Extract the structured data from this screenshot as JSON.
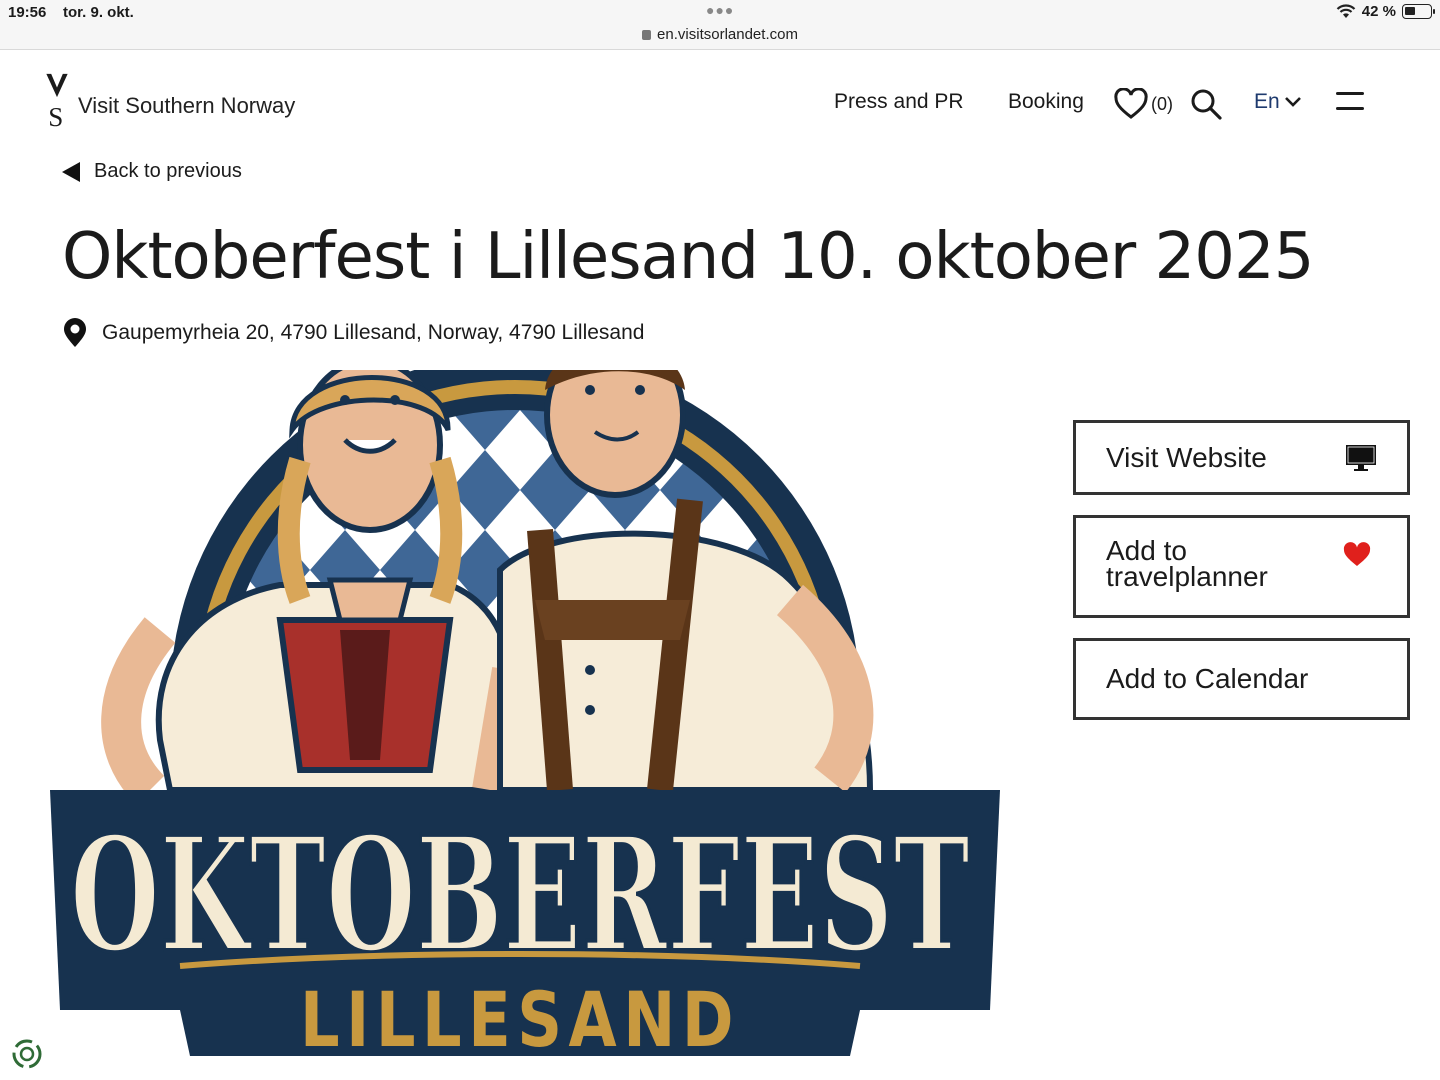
{
  "statusbar": {
    "time": "19:56",
    "date": "tor. 9. okt.",
    "url": "en.visitsorlandet.com",
    "battery": "42 %",
    "battery_level": 0.42
  },
  "header": {
    "logo_text": "Visit Southern Norway",
    "nav": [
      "Press and PR",
      "Booking"
    ],
    "favorites_count": "(0)",
    "language": "En"
  },
  "page": {
    "back_label": "Back to previous",
    "title": "Oktoberfest i Lillesand 10. oktober 2025",
    "address": "Gaupemyrheia 20, 4790 Lillesand, Norway, 4790 Lillesand"
  },
  "hero": {
    "headline": "OKTOBERFEST",
    "subline": "LILLESAND"
  },
  "actions": {
    "visit_website": "Visit Website",
    "add_to_travelplanner_line1": "Add to",
    "add_to_travelplanner_line2": "travelplanner",
    "add_to_calendar": "Add to Calendar"
  },
  "colors": {
    "heart": "#e0201c",
    "lang": "#1e3a6e",
    "navy": "#17324f",
    "cream": "#f4ead3",
    "gold": "#c8993f"
  }
}
